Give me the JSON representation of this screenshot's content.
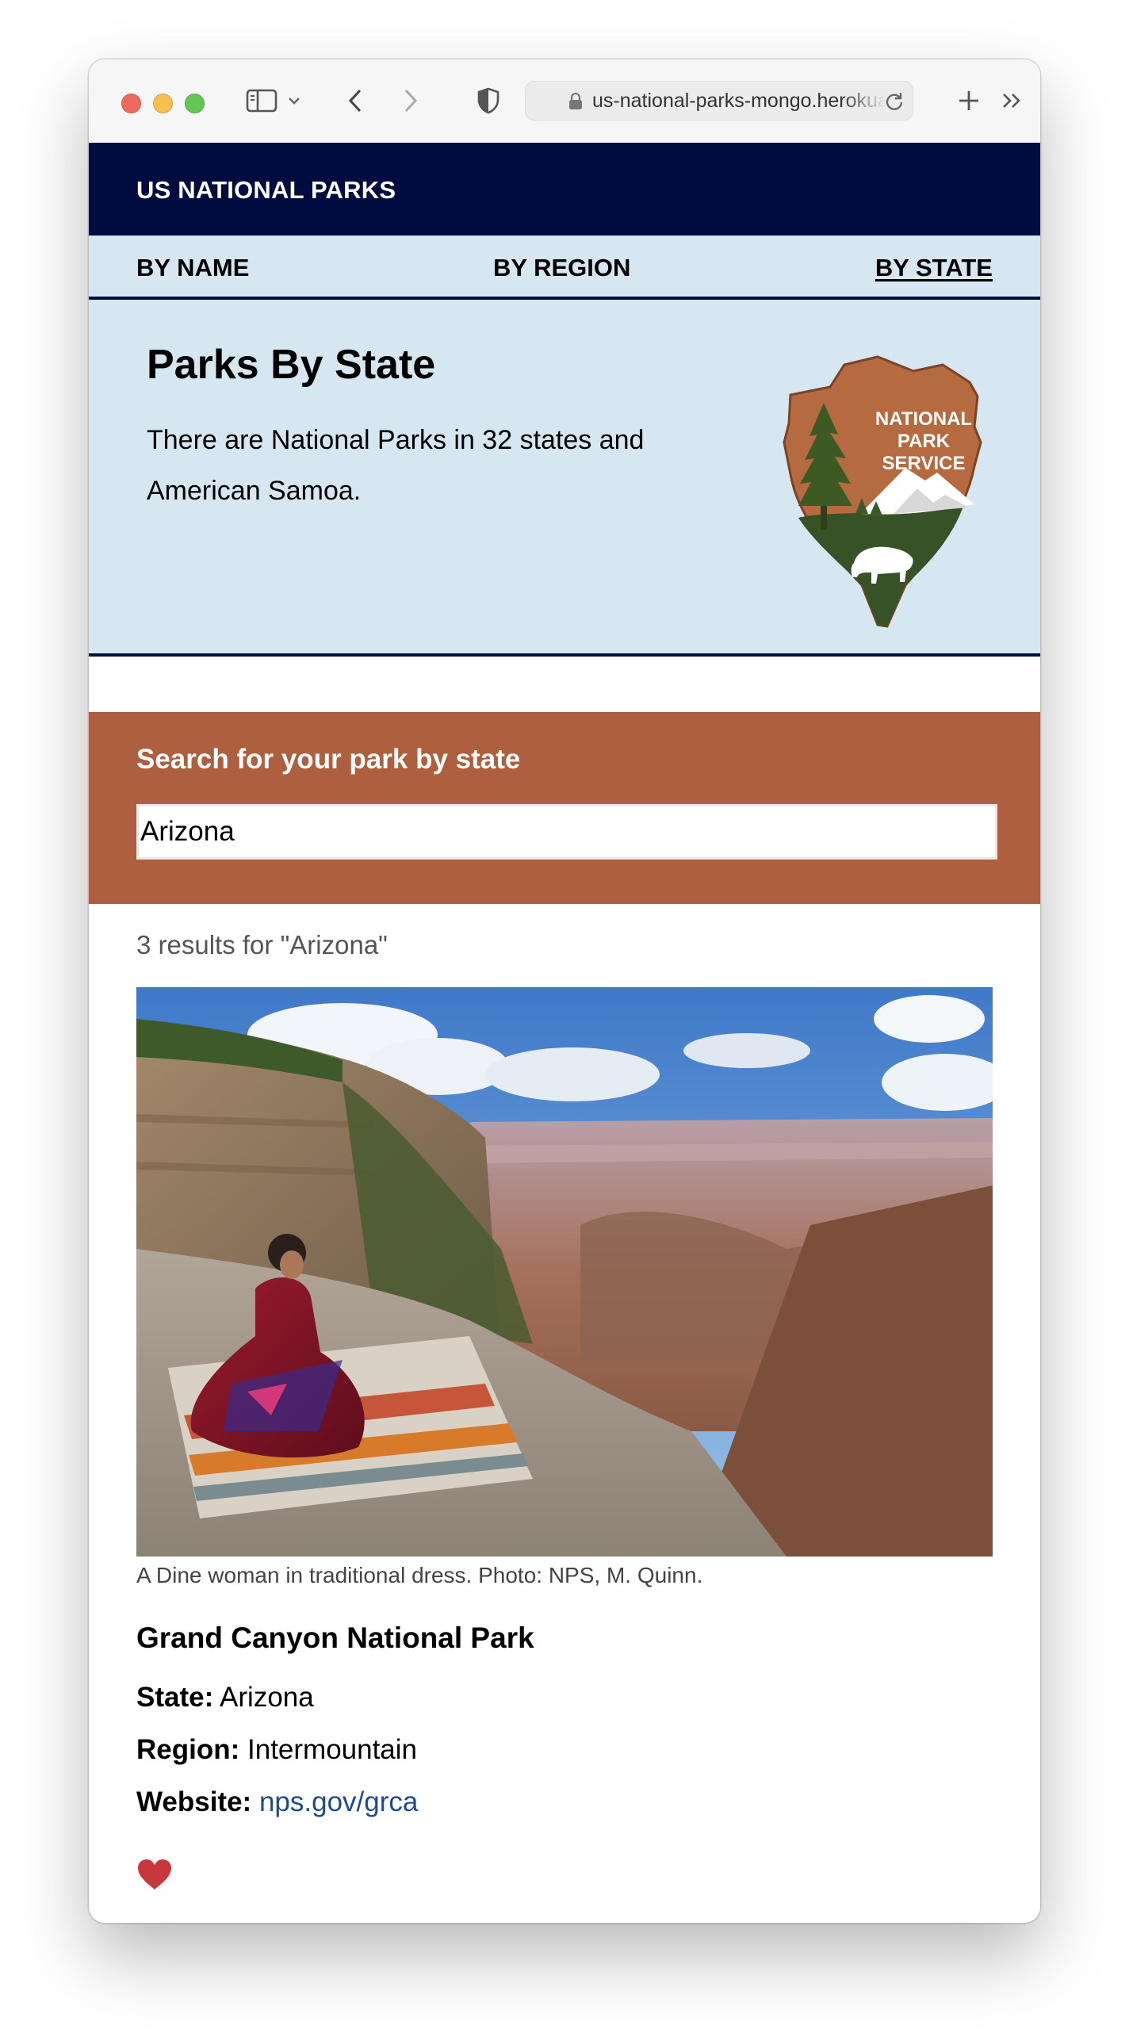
{
  "browser": {
    "url": "us-national-parks-mongo.herokuapp.com"
  },
  "site": {
    "title": "US NATIONAL PARKS"
  },
  "nav": {
    "items": [
      {
        "label": "BY NAME"
      },
      {
        "label": "BY REGION"
      },
      {
        "label": "BY STATE"
      }
    ]
  },
  "hero": {
    "title": "Parks By State",
    "description": "There are National Parks in 32 states and American Samoa.",
    "logo_lines": [
      "NATIONAL",
      "PARK",
      "SERVICE"
    ]
  },
  "search": {
    "label": "Search for your park by state",
    "value": "Arizona"
  },
  "results": {
    "count_text": "3 results for \"Arizona\"",
    "items": [
      {
        "caption": "A Dine woman in traditional dress. Photo: NPS, M. Quinn.",
        "name": "Grand Canyon National Park",
        "state_label": "State:",
        "state": "Arizona",
        "region_label": "Region:",
        "region": "Intermountain",
        "website_label": "Website:",
        "website": "nps.gov/grca",
        "favorite_icon": "heart-icon"
      }
    ]
  },
  "colors": {
    "header": "#000c3f",
    "nav_bg": "#d7e7f1",
    "search_bg": "#ae5f3f",
    "link": "#1e4a8f",
    "heart": "#c8373b"
  }
}
